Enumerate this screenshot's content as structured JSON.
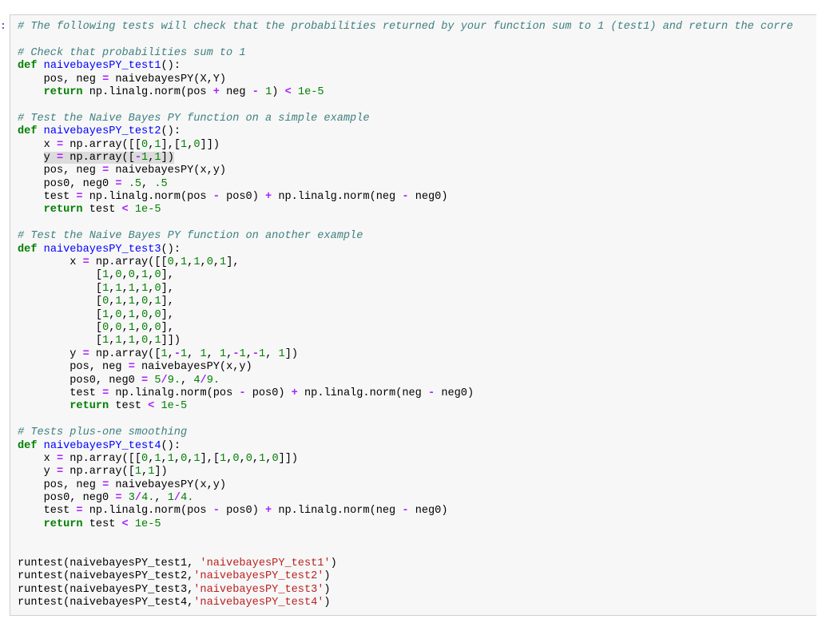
{
  "cell": {
    "prompt": ":",
    "lines": [
      [
        {
          "t": "cm",
          "v": "# The following tests will check that the probabilities returned by your function sum to 1 (test1) and return the corre"
        }
      ],
      [],
      [
        {
          "t": "cm",
          "v": "# Check that probabilities sum to 1"
        }
      ],
      [
        {
          "t": "kw",
          "v": "def"
        },
        {
          "t": "pl",
          "v": " "
        },
        {
          "t": "fn",
          "v": "naivebayesPY_test1"
        },
        {
          "t": "pl",
          "v": "():"
        }
      ],
      [
        {
          "t": "pl",
          "v": "    pos, neg "
        },
        {
          "t": "op",
          "v": "="
        },
        {
          "t": "pl",
          "v": " naivebayesPY(X,Y)"
        }
      ],
      [
        {
          "t": "pl",
          "v": "    "
        },
        {
          "t": "kw",
          "v": "return"
        },
        {
          "t": "pl",
          "v": " np.linalg.norm(pos "
        },
        {
          "t": "op",
          "v": "+"
        },
        {
          "t": "pl",
          "v": " neg "
        },
        {
          "t": "op",
          "v": "-"
        },
        {
          "t": "pl",
          "v": " "
        },
        {
          "t": "nm",
          "v": "1"
        },
        {
          "t": "pl",
          "v": ") "
        },
        {
          "t": "op",
          "v": "<"
        },
        {
          "t": "pl",
          "v": " "
        },
        {
          "t": "nm",
          "v": "1e-5"
        }
      ],
      [],
      [
        {
          "t": "cm",
          "v": "# Test the Naive Bayes PY function on a simple example"
        }
      ],
      [
        {
          "t": "kw",
          "v": "def"
        },
        {
          "t": "pl",
          "v": " "
        },
        {
          "t": "fn",
          "v": "naivebayesPY_test2"
        },
        {
          "t": "pl",
          "v": "():"
        }
      ],
      [
        {
          "t": "pl",
          "v": "    x "
        },
        {
          "t": "op",
          "v": "="
        },
        {
          "t": "pl",
          "v": " np.array([["
        },
        {
          "t": "nm",
          "v": "0"
        },
        {
          "t": "pl",
          "v": ","
        },
        {
          "t": "nm",
          "v": "1"
        },
        {
          "t": "pl",
          "v": "],["
        },
        {
          "t": "nm",
          "v": "1"
        },
        {
          "t": "pl",
          "v": ","
        },
        {
          "t": "nm",
          "v": "0"
        },
        {
          "t": "pl",
          "v": "]])"
        }
      ],
      [
        {
          "t": "pl",
          "v": "    "
        },
        {
          "t": "hl",
          "v": [
            {
              "t": "pl",
              "v": "y "
            },
            {
              "t": "op",
              "v": "="
            },
            {
              "t": "pl",
              "v": " np.array(["
            },
            {
              "t": "op",
              "v": "-"
            },
            {
              "t": "nm",
              "v": "1"
            },
            {
              "t": "pl",
              "v": ","
            },
            {
              "t": "nm",
              "v": "1"
            },
            {
              "t": "pl",
              "v": "])"
            }
          ]
        }
      ],
      [
        {
          "t": "pl",
          "v": "    pos, neg "
        },
        {
          "t": "op",
          "v": "="
        },
        {
          "t": "pl",
          "v": " naivebayesPY(x,y)"
        }
      ],
      [
        {
          "t": "pl",
          "v": "    pos0, neg0 "
        },
        {
          "t": "op",
          "v": "="
        },
        {
          "t": "pl",
          "v": " "
        },
        {
          "t": "nm",
          "v": ".5"
        },
        {
          "t": "pl",
          "v": ", "
        },
        {
          "t": "nm",
          "v": ".5"
        }
      ],
      [
        {
          "t": "pl",
          "v": "    test "
        },
        {
          "t": "op",
          "v": "="
        },
        {
          "t": "pl",
          "v": " np.linalg.norm(pos "
        },
        {
          "t": "op",
          "v": "-"
        },
        {
          "t": "pl",
          "v": " pos0) "
        },
        {
          "t": "op",
          "v": "+"
        },
        {
          "t": "pl",
          "v": " np.linalg.norm(neg "
        },
        {
          "t": "op",
          "v": "-"
        },
        {
          "t": "pl",
          "v": " neg0)"
        }
      ],
      [
        {
          "t": "pl",
          "v": "    "
        },
        {
          "t": "kw",
          "v": "return"
        },
        {
          "t": "pl",
          "v": " test "
        },
        {
          "t": "op",
          "v": "<"
        },
        {
          "t": "pl",
          "v": " "
        },
        {
          "t": "nm",
          "v": "1e-5"
        }
      ],
      [],
      [
        {
          "t": "cm",
          "v": "# Test the Naive Bayes PY function on another example"
        }
      ],
      [
        {
          "t": "kw",
          "v": "def"
        },
        {
          "t": "pl",
          "v": " "
        },
        {
          "t": "fn",
          "v": "naivebayesPY_test3"
        },
        {
          "t": "pl",
          "v": "():"
        }
      ],
      [
        {
          "t": "pl",
          "v": "        x "
        },
        {
          "t": "op",
          "v": "="
        },
        {
          "t": "pl",
          "v": " np.array([["
        },
        {
          "t": "nm",
          "v": "0"
        },
        {
          "t": "pl",
          "v": ","
        },
        {
          "t": "nm",
          "v": "1"
        },
        {
          "t": "pl",
          "v": ","
        },
        {
          "t": "nm",
          "v": "1"
        },
        {
          "t": "pl",
          "v": ","
        },
        {
          "t": "nm",
          "v": "0"
        },
        {
          "t": "pl",
          "v": ","
        },
        {
          "t": "nm",
          "v": "1"
        },
        {
          "t": "pl",
          "v": "],"
        }
      ],
      [
        {
          "t": "pl",
          "v": "            ["
        },
        {
          "t": "nm",
          "v": "1"
        },
        {
          "t": "pl",
          "v": ","
        },
        {
          "t": "nm",
          "v": "0"
        },
        {
          "t": "pl",
          "v": ","
        },
        {
          "t": "nm",
          "v": "0"
        },
        {
          "t": "pl",
          "v": ","
        },
        {
          "t": "nm",
          "v": "1"
        },
        {
          "t": "pl",
          "v": ","
        },
        {
          "t": "nm",
          "v": "0"
        },
        {
          "t": "pl",
          "v": "],"
        }
      ],
      [
        {
          "t": "pl",
          "v": "            ["
        },
        {
          "t": "nm",
          "v": "1"
        },
        {
          "t": "pl",
          "v": ","
        },
        {
          "t": "nm",
          "v": "1"
        },
        {
          "t": "pl",
          "v": ","
        },
        {
          "t": "nm",
          "v": "1"
        },
        {
          "t": "pl",
          "v": ","
        },
        {
          "t": "nm",
          "v": "1"
        },
        {
          "t": "pl",
          "v": ","
        },
        {
          "t": "nm",
          "v": "0"
        },
        {
          "t": "pl",
          "v": "],"
        }
      ],
      [
        {
          "t": "pl",
          "v": "            ["
        },
        {
          "t": "nm",
          "v": "0"
        },
        {
          "t": "pl",
          "v": ","
        },
        {
          "t": "nm",
          "v": "1"
        },
        {
          "t": "pl",
          "v": ","
        },
        {
          "t": "nm",
          "v": "1"
        },
        {
          "t": "pl",
          "v": ","
        },
        {
          "t": "nm",
          "v": "0"
        },
        {
          "t": "pl",
          "v": ","
        },
        {
          "t": "nm",
          "v": "1"
        },
        {
          "t": "pl",
          "v": "],"
        }
      ],
      [
        {
          "t": "pl",
          "v": "            ["
        },
        {
          "t": "nm",
          "v": "1"
        },
        {
          "t": "pl",
          "v": ","
        },
        {
          "t": "nm",
          "v": "0"
        },
        {
          "t": "pl",
          "v": ","
        },
        {
          "t": "nm",
          "v": "1"
        },
        {
          "t": "pl",
          "v": ","
        },
        {
          "t": "nm",
          "v": "0"
        },
        {
          "t": "pl",
          "v": ","
        },
        {
          "t": "nm",
          "v": "0"
        },
        {
          "t": "pl",
          "v": "],"
        }
      ],
      [
        {
          "t": "pl",
          "v": "            ["
        },
        {
          "t": "nm",
          "v": "0"
        },
        {
          "t": "pl",
          "v": ","
        },
        {
          "t": "nm",
          "v": "0"
        },
        {
          "t": "pl",
          "v": ","
        },
        {
          "t": "nm",
          "v": "1"
        },
        {
          "t": "pl",
          "v": ","
        },
        {
          "t": "nm",
          "v": "0"
        },
        {
          "t": "pl",
          "v": ","
        },
        {
          "t": "nm",
          "v": "0"
        },
        {
          "t": "pl",
          "v": "],"
        }
      ],
      [
        {
          "t": "pl",
          "v": "            ["
        },
        {
          "t": "nm",
          "v": "1"
        },
        {
          "t": "pl",
          "v": ","
        },
        {
          "t": "nm",
          "v": "1"
        },
        {
          "t": "pl",
          "v": ","
        },
        {
          "t": "nm",
          "v": "1"
        },
        {
          "t": "pl",
          "v": ","
        },
        {
          "t": "nm",
          "v": "0"
        },
        {
          "t": "pl",
          "v": ","
        },
        {
          "t": "nm",
          "v": "1"
        },
        {
          "t": "pl",
          "v": "]])"
        }
      ],
      [
        {
          "t": "pl",
          "v": "        y "
        },
        {
          "t": "op",
          "v": "="
        },
        {
          "t": "pl",
          "v": " np.array(["
        },
        {
          "t": "nm",
          "v": "1"
        },
        {
          "t": "pl",
          "v": ","
        },
        {
          "t": "op",
          "v": "-"
        },
        {
          "t": "nm",
          "v": "1"
        },
        {
          "t": "pl",
          "v": ", "
        },
        {
          "t": "nm",
          "v": "1"
        },
        {
          "t": "pl",
          "v": ", "
        },
        {
          "t": "nm",
          "v": "1"
        },
        {
          "t": "pl",
          "v": ","
        },
        {
          "t": "op",
          "v": "-"
        },
        {
          "t": "nm",
          "v": "1"
        },
        {
          "t": "pl",
          "v": ","
        },
        {
          "t": "op",
          "v": "-"
        },
        {
          "t": "nm",
          "v": "1"
        },
        {
          "t": "pl",
          "v": ", "
        },
        {
          "t": "nm",
          "v": "1"
        },
        {
          "t": "pl",
          "v": "])"
        }
      ],
      [
        {
          "t": "pl",
          "v": "        pos, neg "
        },
        {
          "t": "op",
          "v": "="
        },
        {
          "t": "pl",
          "v": " naivebayesPY(x,y)"
        }
      ],
      [
        {
          "t": "pl",
          "v": "        pos0, neg0 "
        },
        {
          "t": "op",
          "v": "="
        },
        {
          "t": "pl",
          "v": " "
        },
        {
          "t": "nm",
          "v": "5"
        },
        {
          "t": "op",
          "v": "/"
        },
        {
          "t": "nm",
          "v": "9."
        },
        {
          "t": "pl",
          "v": ", "
        },
        {
          "t": "nm",
          "v": "4"
        },
        {
          "t": "op",
          "v": "/"
        },
        {
          "t": "nm",
          "v": "9."
        }
      ],
      [
        {
          "t": "pl",
          "v": "        test "
        },
        {
          "t": "op",
          "v": "="
        },
        {
          "t": "pl",
          "v": " np.linalg.norm(pos "
        },
        {
          "t": "op",
          "v": "-"
        },
        {
          "t": "pl",
          "v": " pos0) "
        },
        {
          "t": "op",
          "v": "+"
        },
        {
          "t": "pl",
          "v": " np.linalg.norm(neg "
        },
        {
          "t": "op",
          "v": "-"
        },
        {
          "t": "pl",
          "v": " neg0)"
        }
      ],
      [
        {
          "t": "pl",
          "v": "        "
        },
        {
          "t": "kw",
          "v": "return"
        },
        {
          "t": "pl",
          "v": " test "
        },
        {
          "t": "op",
          "v": "<"
        },
        {
          "t": "pl",
          "v": " "
        },
        {
          "t": "nm",
          "v": "1e-5"
        }
      ],
      [],
      [
        {
          "t": "cm",
          "v": "# Tests plus-one smoothing"
        }
      ],
      [
        {
          "t": "kw",
          "v": "def"
        },
        {
          "t": "pl",
          "v": " "
        },
        {
          "t": "fn",
          "v": "naivebayesPY_test4"
        },
        {
          "t": "pl",
          "v": "():"
        }
      ],
      [
        {
          "t": "pl",
          "v": "    x "
        },
        {
          "t": "op",
          "v": "="
        },
        {
          "t": "pl",
          "v": " np.array([["
        },
        {
          "t": "nm",
          "v": "0"
        },
        {
          "t": "pl",
          "v": ","
        },
        {
          "t": "nm",
          "v": "1"
        },
        {
          "t": "pl",
          "v": ","
        },
        {
          "t": "nm",
          "v": "1"
        },
        {
          "t": "pl",
          "v": ","
        },
        {
          "t": "nm",
          "v": "0"
        },
        {
          "t": "pl",
          "v": ","
        },
        {
          "t": "nm",
          "v": "1"
        },
        {
          "t": "pl",
          "v": "],["
        },
        {
          "t": "nm",
          "v": "1"
        },
        {
          "t": "pl",
          "v": ","
        },
        {
          "t": "nm",
          "v": "0"
        },
        {
          "t": "pl",
          "v": ","
        },
        {
          "t": "nm",
          "v": "0"
        },
        {
          "t": "pl",
          "v": ","
        },
        {
          "t": "nm",
          "v": "1"
        },
        {
          "t": "pl",
          "v": ","
        },
        {
          "t": "nm",
          "v": "0"
        },
        {
          "t": "pl",
          "v": "]])"
        }
      ],
      [
        {
          "t": "pl",
          "v": "    y "
        },
        {
          "t": "op",
          "v": "="
        },
        {
          "t": "pl",
          "v": " np.array(["
        },
        {
          "t": "nm",
          "v": "1"
        },
        {
          "t": "pl",
          "v": ","
        },
        {
          "t": "nm",
          "v": "1"
        },
        {
          "t": "pl",
          "v": "])"
        }
      ],
      [
        {
          "t": "pl",
          "v": "    pos, neg "
        },
        {
          "t": "op",
          "v": "="
        },
        {
          "t": "pl",
          "v": " naivebayesPY(x,y)"
        }
      ],
      [
        {
          "t": "pl",
          "v": "    pos0, neg0 "
        },
        {
          "t": "op",
          "v": "="
        },
        {
          "t": "pl",
          "v": " "
        },
        {
          "t": "nm",
          "v": "3"
        },
        {
          "t": "op",
          "v": "/"
        },
        {
          "t": "nm",
          "v": "4."
        },
        {
          "t": "pl",
          "v": ", "
        },
        {
          "t": "nm",
          "v": "1"
        },
        {
          "t": "op",
          "v": "/"
        },
        {
          "t": "nm",
          "v": "4."
        }
      ],
      [
        {
          "t": "pl",
          "v": "    test "
        },
        {
          "t": "op",
          "v": "="
        },
        {
          "t": "pl",
          "v": " np.linalg.norm(pos "
        },
        {
          "t": "op",
          "v": "-"
        },
        {
          "t": "pl",
          "v": " pos0) "
        },
        {
          "t": "op",
          "v": "+"
        },
        {
          "t": "pl",
          "v": " np.linalg.norm(neg "
        },
        {
          "t": "op",
          "v": "-"
        },
        {
          "t": "pl",
          "v": " neg0)"
        }
      ],
      [
        {
          "t": "pl",
          "v": "    "
        },
        {
          "t": "kw",
          "v": "return"
        },
        {
          "t": "pl",
          "v": " test "
        },
        {
          "t": "op",
          "v": "<"
        },
        {
          "t": "pl",
          "v": " "
        },
        {
          "t": "nm",
          "v": "1e-5"
        }
      ],
      [],
      [],
      [
        {
          "t": "pl",
          "v": "runtest(naivebayesPY_test1, "
        },
        {
          "t": "st",
          "v": "'naivebayesPY_test1'"
        },
        {
          "t": "pl",
          "v": ")"
        }
      ],
      [
        {
          "t": "pl",
          "v": "runtest(naivebayesPY_test2,"
        },
        {
          "t": "st",
          "v": "'naivebayesPY_test2'"
        },
        {
          "t": "pl",
          "v": ")"
        }
      ],
      [
        {
          "t": "pl",
          "v": "runtest(naivebayesPY_test3,"
        },
        {
          "t": "st",
          "v": "'naivebayesPY_test3'"
        },
        {
          "t": "pl",
          "v": ")"
        }
      ],
      [
        {
          "t": "pl",
          "v": "runtest(naivebayesPY_test4,"
        },
        {
          "t": "st",
          "v": "'naivebayesPY_test4'"
        },
        {
          "t": "pl",
          "v": ")"
        }
      ]
    ]
  }
}
